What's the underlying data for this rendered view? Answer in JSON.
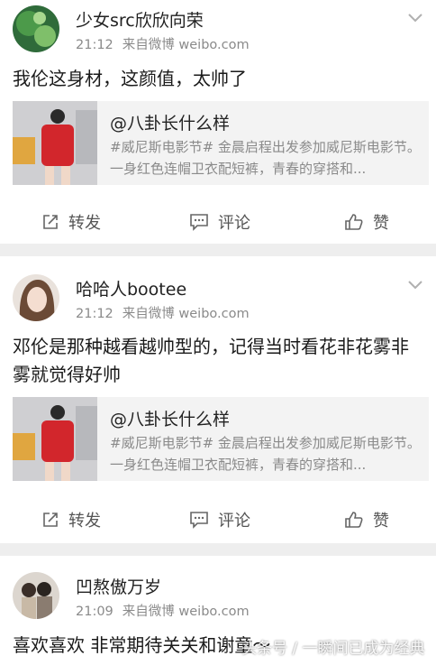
{
  "posts": [
    {
      "username": "少女src欣欣向荣",
      "time": "21:12",
      "source": "来自微博 weibo.com",
      "text": "我伦这身材，这颜值，太帅了",
      "repost": {
        "author": "@八卦长什么样",
        "text": "#威尼斯电影节# 金晨启程出发参加威尼斯电影节。一身红色连帽卫衣配短裤，青春的穿搭和..."
      },
      "actions": {
        "forward": "转发",
        "comment": "评论",
        "like": "赞"
      }
    },
    {
      "username": "哈哈人bootee",
      "time": "21:12",
      "source": "来自微博 weibo.com",
      "text": "邓伦是那种越看越帅型的，记得当时看花非花雾非雾就觉得好帅",
      "repost": {
        "author": "@八卦长什么样",
        "text": "#威尼斯电影节# 金晨启程出发参加威尼斯电影节。一身红色连帽卫衣配短裤，青春的穿搭和..."
      },
      "actions": {
        "forward": "转发",
        "comment": "评论",
        "like": "赞"
      }
    },
    {
      "username": "凹熬傲万岁",
      "time": "21:09",
      "source": "来自微博 weibo.com",
      "text": "喜欢喜欢  非常期待关关和谢童～"
    }
  ],
  "watermark": "头条号 / 一瞬间已成为经典",
  "colors": {
    "text": "#1a1a1a",
    "meta": "#8a8a8a",
    "repost_bg": "#f3f3f3",
    "separator": "#eeeeee"
  },
  "icons": {
    "forward": "share-icon",
    "comment": "comment-icon",
    "like": "thumbs-up-icon",
    "menu": "chevron-down-icon"
  }
}
